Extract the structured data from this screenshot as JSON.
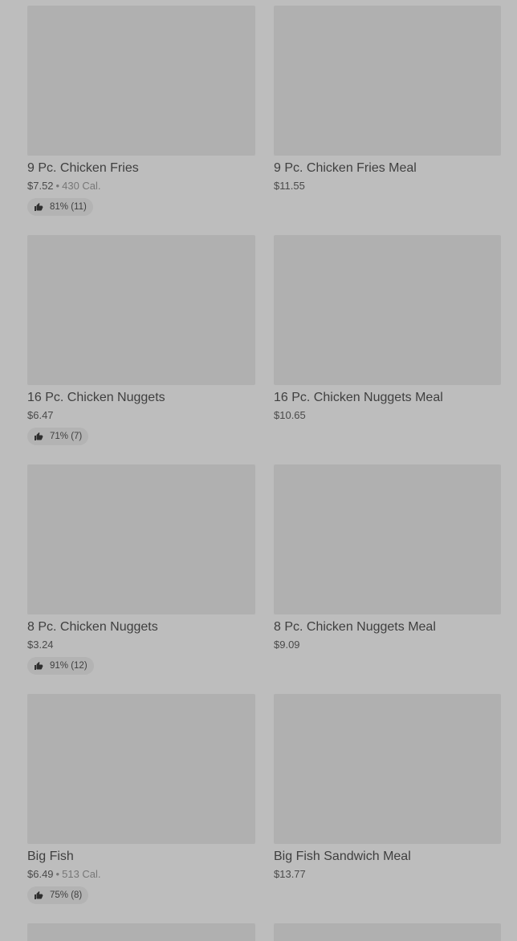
{
  "rows": [
    {
      "left": {
        "name": "9 Pc. Chicken Fries",
        "price": "$7.52",
        "calories": "430 Cal.",
        "rating": "81% (11)"
      },
      "right": {
        "name": "9 Pc. Chicken Fries Meal",
        "price": "$11.55"
      }
    },
    {
      "left": {
        "name": "16 Pc. Chicken Nuggets",
        "price": "$6.47",
        "rating": "71% (7)"
      },
      "right": {
        "name": "16 Pc. Chicken Nuggets Meal",
        "price": "$10.65"
      }
    },
    {
      "left": {
        "name": "8 Pc. Chicken Nuggets",
        "price": "$3.24",
        "rating": "91% (12)"
      },
      "right": {
        "name": "8 Pc. Chicken Nuggets Meal",
        "price": "$9.09"
      }
    },
    {
      "left": {
        "name": "Big Fish",
        "price": "$6.49",
        "calories": "513 Cal.",
        "rating": "75% (8)"
      },
      "right": {
        "name": "Big Fish Sandwich Meal",
        "price": "$13.77"
      }
    }
  ],
  "icons": {
    "rating": "thumbs-up-icon"
  }
}
